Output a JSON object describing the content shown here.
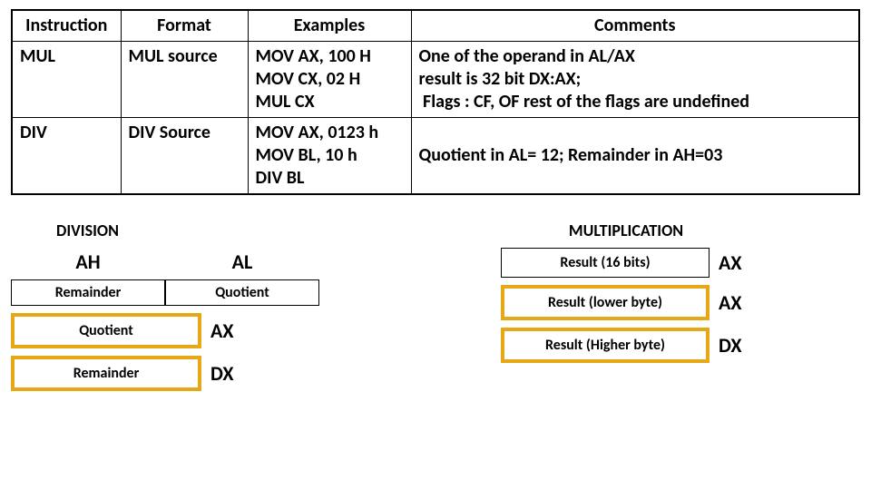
{
  "table": {
    "headers": {
      "c1": "Instruction",
      "c2": "Format",
      "c3": "Examples",
      "c4": "Comments"
    },
    "rows": [
      {
        "instr": "MUL",
        "format": "MUL source",
        "examples": "MOV AX, 100 H\nMOV CX, 02 H\nMUL CX",
        "comments": "One of the operand in AL/AX\nresult is 32 bit DX:AX;\n Flags : CF, OF rest of the flags are undefined"
      },
      {
        "instr": "DIV",
        "format": "DIV Source",
        "examples": "MOV AX, 0123 h\nMOV BL, 10 h\nDIV BL",
        "comments": "\nQuotient in AL= 12; Remainder in AH=03"
      }
    ]
  },
  "division": {
    "title": "DIVISION",
    "reg_hi": "AH",
    "reg_lo": "AL",
    "box_hi": "Remainder",
    "box_lo": "Quotient",
    "row1_label": "Quotient",
    "row1_reg": "AX",
    "row2_label": "Remainder",
    "row2_reg": "DX"
  },
  "multiplication": {
    "title": "MULTIPLICATION",
    "row0_label": "Result (16 bits)",
    "row0_reg": "AX",
    "row1_label": "Result (lower byte)",
    "row1_reg": "AX",
    "row2_label": "Result (Higher byte)",
    "row2_reg": "DX"
  }
}
